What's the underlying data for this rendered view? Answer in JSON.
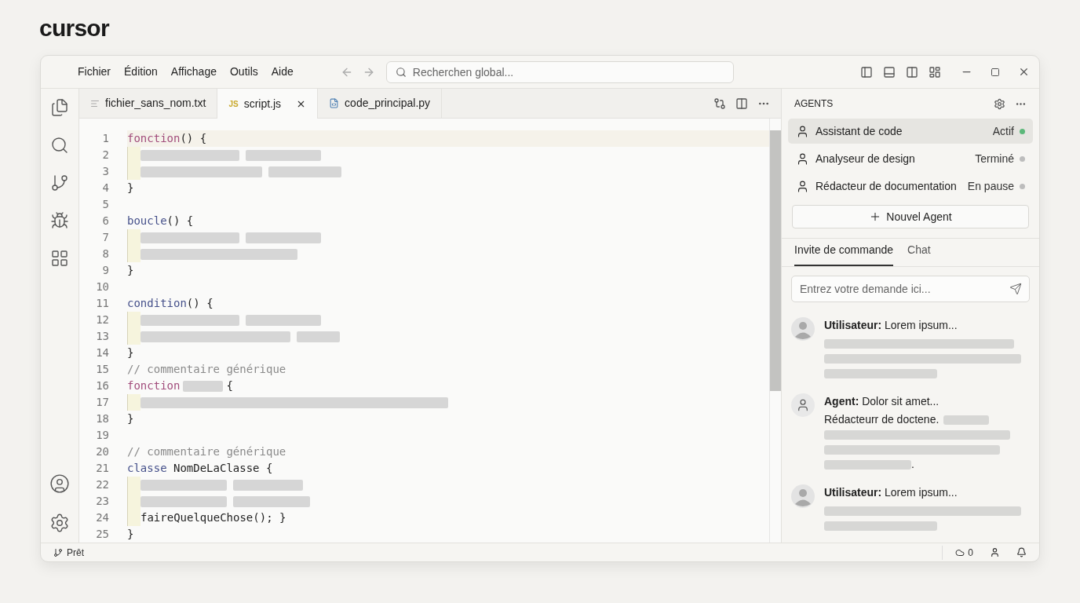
{
  "brand": "cursor",
  "menu": [
    "Fichier",
    "Édition",
    "Affichage",
    "Outils",
    "Aide"
  ],
  "search": {
    "placeholder": "Recherchen global..."
  },
  "tabs": [
    {
      "kind": "txt",
      "label": "fichier_sans_nom.txt",
      "selected": false
    },
    {
      "kind": "js",
      "badge": "JS",
      "label": "script.js",
      "selected": true
    },
    {
      "kind": "py",
      "label": "code_principal.py",
      "selected": false
    }
  ],
  "code": [
    {
      "n": "1",
      "current": true,
      "block": false,
      "tokens": [
        {
          "kind": "keyword",
          "text": "fonction"
        },
        {
          "kind": "plain",
          "text": "() {"
        }
      ]
    },
    {
      "n": "2",
      "current": false,
      "block": true,
      "tokens": [
        {
          "kind": "placeholder"
        },
        {
          "kind": "placeholder"
        }
      ]
    },
    {
      "n": "3",
      "current": false,
      "block": true,
      "tokens": [
        {
          "kind": "placeholder"
        },
        {
          "kind": "placeholder"
        }
      ]
    },
    {
      "n": "4",
      "current": false,
      "block": false,
      "tokens": [
        {
          "kind": "plain",
          "text": "}"
        }
      ]
    },
    {
      "n": "5",
      "current": false,
      "block": false
    },
    {
      "n": "6",
      "current": false,
      "block": false,
      "tokens": [
        {
          "kind": "function",
          "text": "boucle"
        },
        {
          "kind": "plain",
          "text": "() {"
        }
      ]
    },
    {
      "n": "7",
      "current": false,
      "block": true,
      "tokens": [
        {
          "kind": "placeholder"
        },
        {
          "kind": "placeholder"
        }
      ]
    },
    {
      "n": "8",
      "current": false,
      "block": true,
      "tokens": [
        {
          "kind": "placeholder"
        }
      ]
    },
    {
      "n": "9",
      "current": false,
      "block": false,
      "tokens": [
        {
          "kind": "plain",
          "text": "}"
        }
      ]
    },
    {
      "n": "10",
      "current": false,
      "block": false
    },
    {
      "n": "11",
      "current": false,
      "block": false,
      "tokens": [
        {
          "kind": "function",
          "text": "condition"
        },
        {
          "kind": "plain",
          "text": "() {"
        }
      ]
    },
    {
      "n": "12",
      "current": false,
      "block": true,
      "tokens": [
        {
          "kind": "placeholder"
        },
        {
          "kind": "placeholder"
        }
      ]
    },
    {
      "n": "13",
      "current": false,
      "block": true,
      "tokens": [
        {
          "kind": "placeholder"
        },
        {
          "kind": "placeholder"
        }
      ]
    },
    {
      "n": "14",
      "current": false,
      "block": false,
      "tokens": [
        {
          "kind": "plain",
          "text": "}"
        }
      ]
    },
    {
      "n": "15",
      "current": false,
      "block": false,
      "tokens": [
        {
          "kind": "comment",
          "text": "// commentaire générique"
        }
      ]
    },
    {
      "n": "16",
      "current": false,
      "block": false,
      "tokens": [
        {
          "kind": "keyword",
          "text": "fonction"
        },
        {
          "kind": "placeholder"
        },
        {
          "kind": "plain",
          "text": "{"
        }
      ]
    },
    {
      "n": "17",
      "current": false,
      "block": true,
      "tokens": [
        {
          "kind": "placeholder"
        }
      ]
    },
    {
      "n": "18",
      "current": false,
      "block": false,
      "tokens": [
        {
          "kind": "plain",
          "text": "}"
        }
      ]
    },
    {
      "n": "19",
      "current": false,
      "block": false
    },
    {
      "n": "20",
      "current": false,
      "block": false,
      "tokens": [
        {
          "kind": "comment",
          "text": "// commentaire générique"
        }
      ]
    },
    {
      "n": "21",
      "current": false,
      "block": false,
      "tokens": [
        {
          "kind": "function",
          "text": "classe"
        },
        {
          "kind": "plain",
          "text": "NomDeLaClasse {",
          "spaced": true
        }
      ]
    },
    {
      "n": "22",
      "current": false,
      "block": true,
      "tokens": [
        {
          "kind": "placeholder"
        },
        {
          "kind": "placeholder"
        }
      ]
    },
    {
      "n": "23",
      "current": false,
      "block": true,
      "tokens": [
        {
          "kind": "placeholder"
        },
        {
          "kind": "placeholder"
        }
      ]
    },
    {
      "n": "24",
      "current": false,
      "block": true,
      "tokens": [
        {
          "kind": "plain",
          "text": "faireQuelqueChose(); }"
        }
      ]
    },
    {
      "n": "25",
      "current": false,
      "block": false,
      "tokens": [
        {
          "kind": "plain",
          "text": "}"
        }
      ]
    }
  ],
  "agents_panel": {
    "title": "AGENTS",
    "agents": [
      {
        "name": "Assistant de code",
        "status": "Actif",
        "color": "#5cb87a",
        "selected": true
      },
      {
        "name": "Analyseur de design",
        "status": "Terminé",
        "color": "#bdbdbd",
        "selected": false
      },
      {
        "name": "Rédacteur de documentation",
        "status": "En pause",
        "color": "#bdbdbd",
        "selected": false
      }
    ],
    "new_agent": "Nouvel Agent",
    "tabs": [
      {
        "label": "Invite de commande",
        "selected": true
      },
      {
        "label": "Chat",
        "selected": false
      }
    ],
    "prompt": {
      "placeholder": "Entrez votre demande ici..."
    },
    "messages": [
      {
        "kind": "user",
        "text": "**Utilisateur:** Lorem ipsum...",
        "lines": [
          [
            {
              "kind": "placeholder"
            }
          ],
          [
            {
              "kind": "placeholder"
            }
          ],
          [
            {
              "kind": "placeholder"
            }
          ]
        ]
      },
      {
        "kind": "agent",
        "text": "**Agent:** Dolor sit amet...",
        "lines": [
          [
            {
              "kind": "text",
              "text": "Rédacteurr de doctene."
            },
            {
              "kind": "placeholder"
            }
          ],
          [
            {
              "kind": "placeholder"
            }
          ],
          [
            {
              "kind": "placeholder"
            }
          ],
          [
            {
              "kind": "placeholder"
            },
            {
              "kind": "text",
              "text": "."
            }
          ]
        ]
      },
      {
        "kind": "user",
        "text": "**Utilisateur:** Lorem ipsum...",
        "lines": [
          [
            {
              "kind": "placeholder"
            }
          ],
          [
            {
              "kind": "placeholder"
            }
          ]
        ]
      }
    ]
  },
  "status_bar": {
    "branch": "Prêt",
    "sync": "0"
  }
}
